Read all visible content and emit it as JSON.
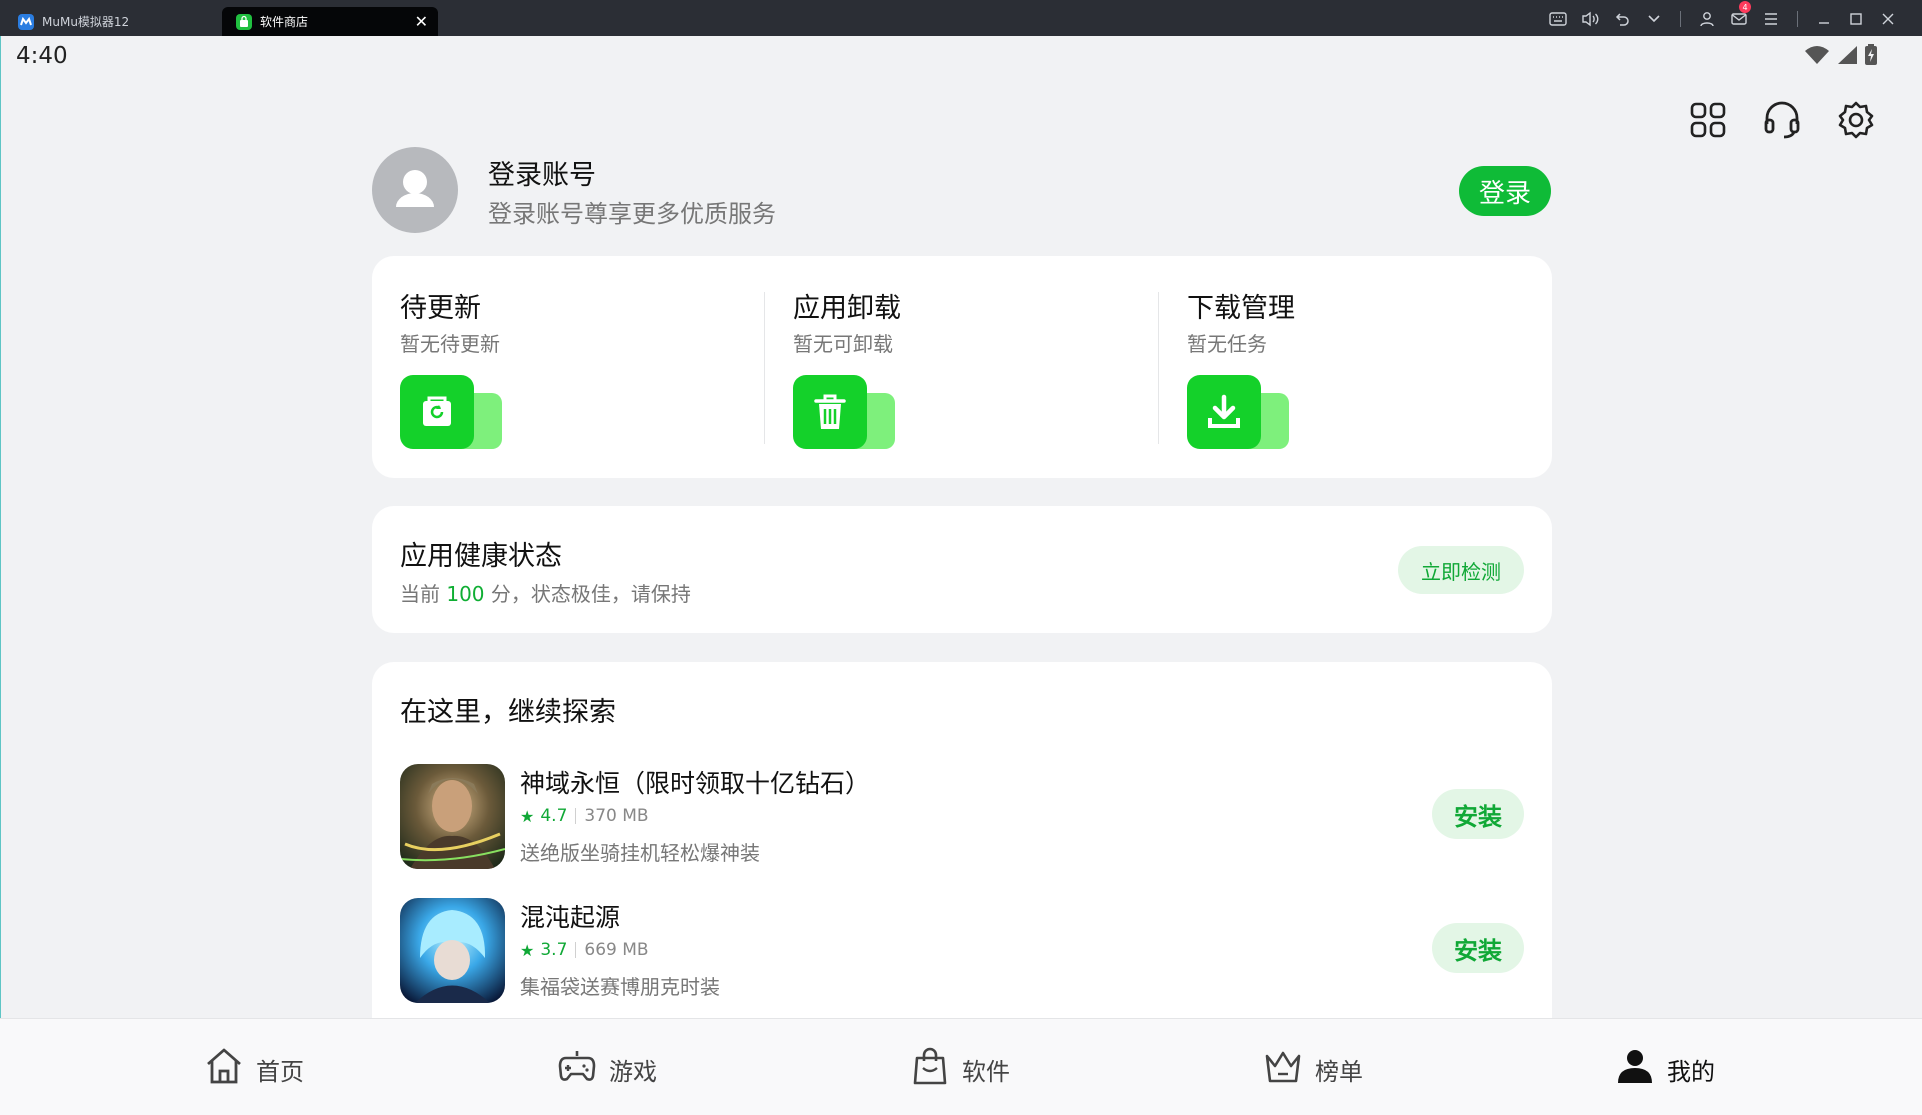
{
  "window": {
    "tabs": [
      {
        "label": "MuMu模拟器12",
        "icon": "mumu-logo-icon"
      },
      {
        "label": "软件商店",
        "icon": "store-icon",
        "active": true
      }
    ],
    "mail_badge": "4"
  },
  "status_bar": {
    "time": "4:40"
  },
  "profile": {
    "title": "登录账号",
    "subtitle": "登录账号尊享更多优质服务",
    "login_label": "登录"
  },
  "quick": [
    {
      "title": "待更新",
      "sub": "暂无待更新",
      "icon": "refresh-icon"
    },
    {
      "title": "应用卸载",
      "sub": "暂无可卸载",
      "icon": "trash-icon"
    },
    {
      "title": "下载管理",
      "sub": "暂无任务",
      "icon": "download-icon"
    }
  ],
  "health": {
    "title": "应用健康状态",
    "prefix": "当前",
    "score": "100",
    "suffix": "分，状态极佳，请保持",
    "button": "立即检测"
  },
  "explore": {
    "title": "在这里，继续探索",
    "apps": [
      {
        "name": "神域永恒（限时领取十亿钻石）",
        "rating": "4.7",
        "size": "370 MB",
        "desc": "送绝版坐骑挂机轻松爆神装",
        "install": "安装"
      },
      {
        "name": "混沌起源",
        "rating": "3.7",
        "size": "669 MB",
        "desc": "集福袋送赛博朋克时装",
        "install": "安装"
      }
    ]
  },
  "nav": [
    {
      "label": "首页",
      "icon": "home-icon"
    },
    {
      "label": "游戏",
      "icon": "gamepad-icon"
    },
    {
      "label": "软件",
      "icon": "shopping-bag-icon"
    },
    {
      "label": "榜单",
      "icon": "crown-icon"
    },
    {
      "label": "我的",
      "icon": "person-icon",
      "active": true
    }
  ],
  "colors": {
    "accent": "#0fbb37",
    "accent_soft": "#e3f6e6",
    "background": "#f1f2f4"
  }
}
